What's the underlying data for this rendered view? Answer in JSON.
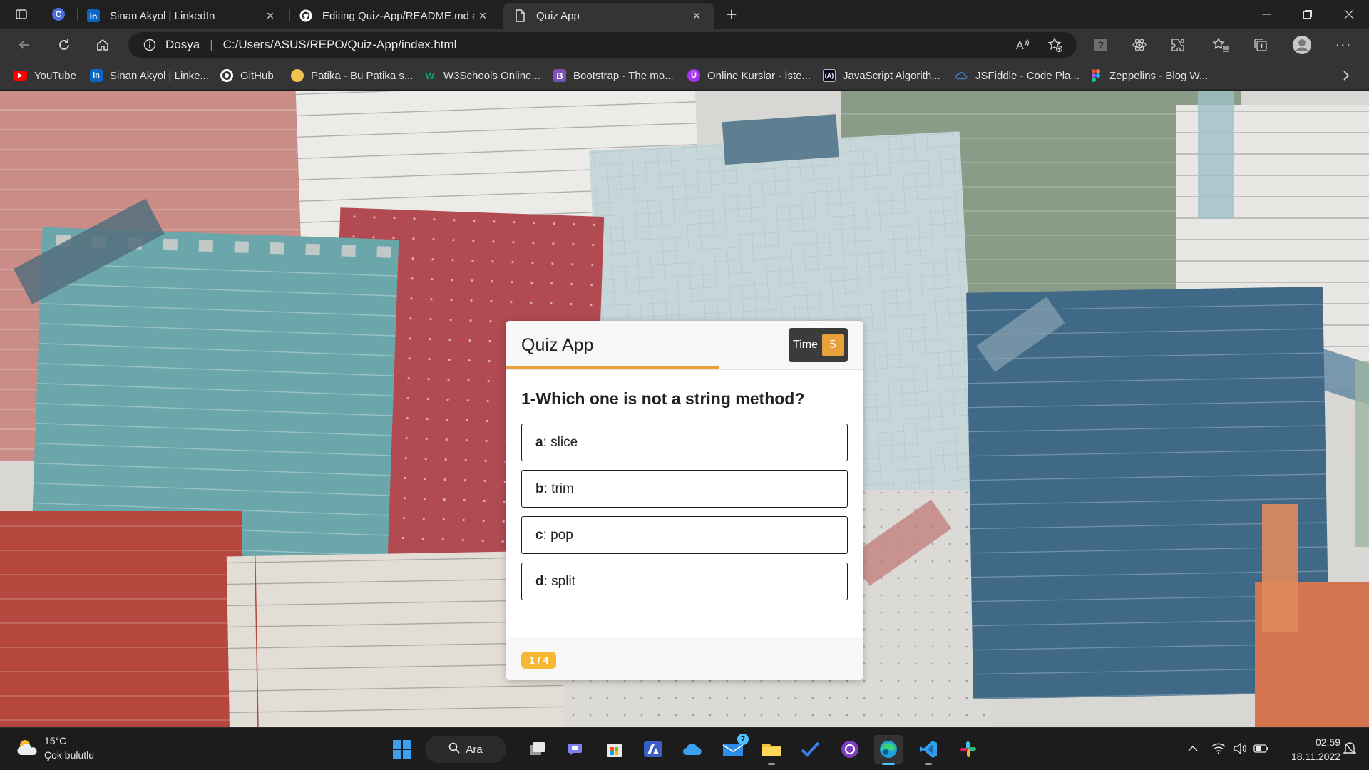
{
  "browser": {
    "tabs": [
      {
        "title": "Sinan Akyol | LinkedIn",
        "active": false
      },
      {
        "title": "Editing Quiz-App/README.md a",
        "active": false
      },
      {
        "title": "Quiz App",
        "active": true
      }
    ],
    "address": {
      "scheme_label": "Dosya",
      "url": "C:/Users/ASUS/REPO/Quiz-App/index.html"
    },
    "bookmarks": [
      {
        "label": "YouTube",
        "icon": "youtube-icon",
        "color": "#ff0000"
      },
      {
        "label": "Sinan Akyol | Linke...",
        "icon": "linkedin-icon",
        "color": "#0a66c2"
      },
      {
        "label": "GitHub",
        "icon": "github-icon",
        "color": "#ffffff"
      },
      {
        "label": "Patika - Bu Patika s...",
        "icon": "patika-icon",
        "color": "#f2c14e"
      },
      {
        "label": "W3Schools Online...",
        "icon": "w3schools-icon",
        "color": "#04aa6d"
      },
      {
        "label": "Bootstrap · The mo...",
        "icon": "bootstrap-icon",
        "color": "#7952b3"
      },
      {
        "label": "Online Kurslar - İste...",
        "icon": "udemy-icon",
        "color": "#a435f0"
      },
      {
        "label": "JavaScript Algorith...",
        "icon": "freecodecamp-icon",
        "color": "#ffffff"
      },
      {
        "label": "JSFiddle - Code Pla...",
        "icon": "jsfiddle-icon",
        "color": "#4679bd"
      },
      {
        "label": "Zeppelins - Blog W...",
        "icon": "figma-icon",
        "color": "#f24e1e"
      }
    ]
  },
  "quiz": {
    "title": "Quiz App",
    "timer_label": "Time",
    "timer_value": "5",
    "question": "1-Which one is not a string method?",
    "options": [
      {
        "letter": "a",
        "text": ": slice"
      },
      {
        "letter": "b",
        "text": ": trim"
      },
      {
        "letter": "c",
        "text": ": pop"
      },
      {
        "letter": "d",
        "text": ": split"
      }
    ],
    "progress": "1 / 4",
    "accent_color": "#e8a13a"
  },
  "taskbar": {
    "weather_temp": "15°C",
    "weather_desc": "Çok bulutlu",
    "search_label": "Ara",
    "mail_badge": "7",
    "clock_time": "02:59",
    "clock_date": "18.11.2022"
  }
}
